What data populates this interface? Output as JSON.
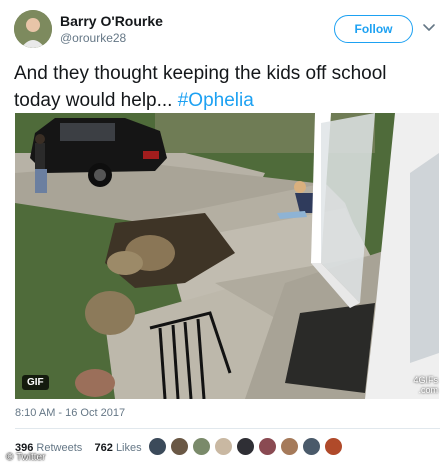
{
  "author": {
    "name": "Barry O'Rourke",
    "handle": "@orourke28",
    "avatar_icon": "profile-avatar"
  },
  "follow": {
    "label": "Follow"
  },
  "menu": {
    "icon": "chevron-down-icon"
  },
  "tweet": {
    "text": "And they thought keeping the kids off school today would help... ",
    "hashtag": "#Ophelia"
  },
  "media": {
    "badge": "GIF",
    "watermark_line1": "4GIFs",
    "watermark_line2": ".com"
  },
  "meta": {
    "timestamp": "8:10 AM - 16 Oct 2017"
  },
  "stats": {
    "retweets_count": "396",
    "retweets_label": "Retweets",
    "likes_count": "762",
    "likes_label": "Likes"
  },
  "credit": "© Twitter",
  "colors": {
    "accent": "#1da1f2",
    "text": "#14171a",
    "muted": "#657786",
    "divider": "#e1e8ed"
  }
}
